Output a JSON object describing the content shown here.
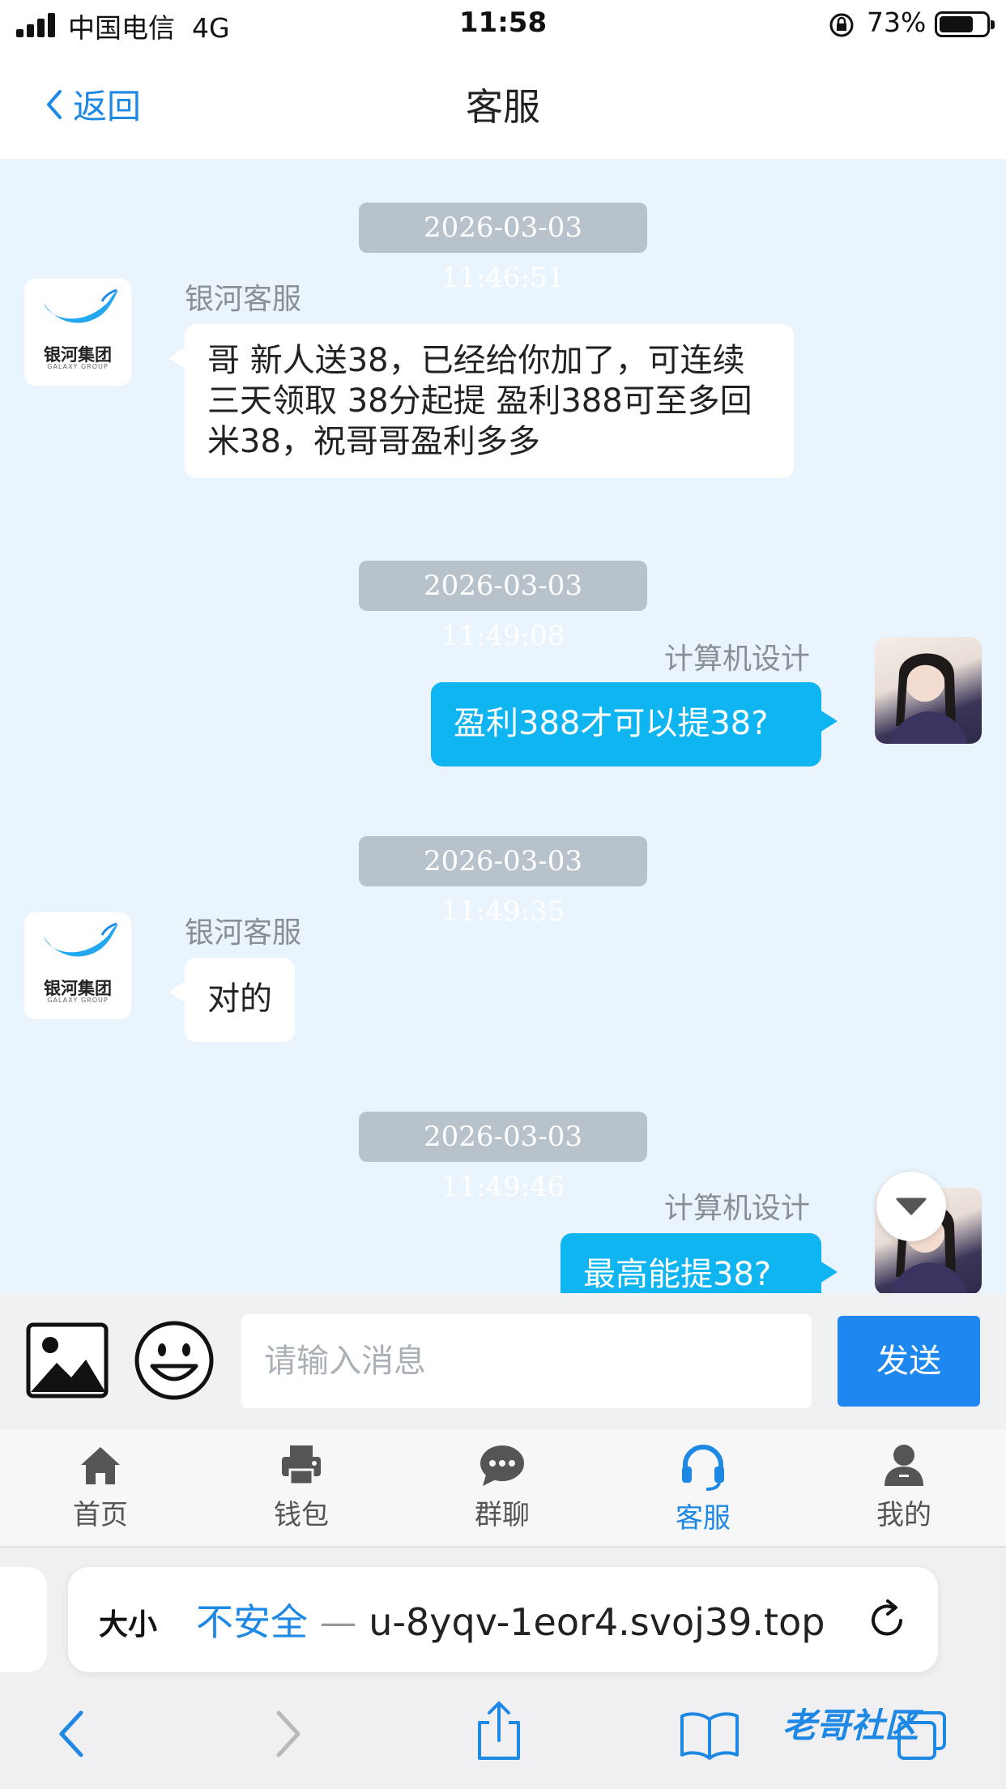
{
  "status_bar": {
    "carrier": "中国电信",
    "network": "4G",
    "time": "11:58",
    "battery": "73%"
  },
  "nav": {
    "back_label": "返回",
    "title": "客服"
  },
  "messages": [
    {
      "timestamp": "2026-03-03 11:46:51",
      "side": "left",
      "sender": "银河客服",
      "text": "哥   新人送38，已经给你加了，可连续三天领取 38分起提  盈利388可至多回米38，祝哥哥盈利多多"
    },
    {
      "timestamp": "2026-03-03 11:49:08",
      "side": "right",
      "sender": "计算机设计",
      "text": "盈利388才可以提38?"
    },
    {
      "timestamp": "2026-03-03 11:49:35",
      "side": "left",
      "sender": "银河客服",
      "text": "对的"
    },
    {
      "timestamp": "2026-03-03 11:49:46",
      "side": "right",
      "sender": "计算机设计",
      "text": "最高能提38?"
    }
  ],
  "logo": {
    "name": "银河集团",
    "sub": "GALAXY GROUP"
  },
  "input": {
    "placeholder": "请输入消息",
    "send_label": "发送"
  },
  "tabs": [
    {
      "label": "首页",
      "icon": "home-icon"
    },
    {
      "label": "钱包",
      "icon": "printer-icon"
    },
    {
      "label": "群聊",
      "icon": "chat-icon"
    },
    {
      "label": "客服",
      "icon": "headset-icon",
      "active": true
    },
    {
      "label": "我的",
      "icon": "user-icon"
    }
  ],
  "browser": {
    "text_size": "大小",
    "insecure": "不安全",
    "separator": "—",
    "url": "u-8yqv-1eor4.svoj39.top"
  },
  "watermark": "老哥社区",
  "colors": {
    "accent": "#1e88e5",
    "chat_bg": "#e9f4fd",
    "right_bubble": "#0fb5f0",
    "timestamp_bg": "#b8c2ca"
  }
}
